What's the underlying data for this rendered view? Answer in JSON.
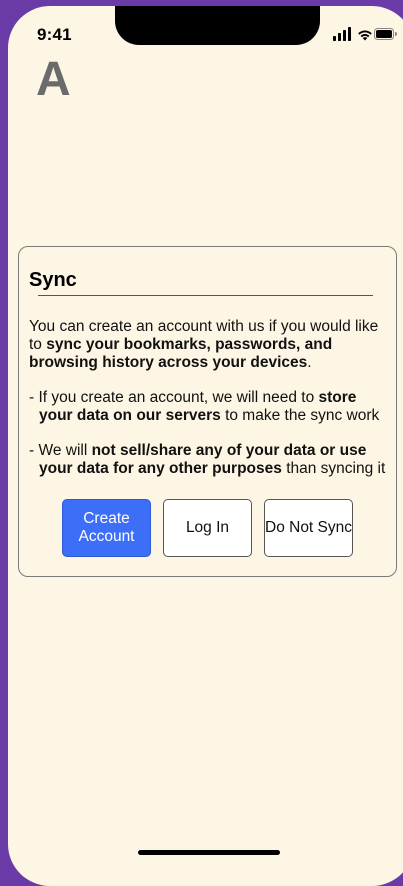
{
  "status_bar": {
    "time": "9:41",
    "icons": [
      "signal-icon",
      "wifi-icon",
      "battery-icon"
    ]
  },
  "app": {
    "logo_letter": "A"
  },
  "dialog": {
    "title": "Sync",
    "intro_prefix": "You can create an account with us if you would like to ",
    "intro_bold": "sync your bookmarks, passwords, and browsing history across your devices",
    "intro_suffix": ".",
    "bullet1_prefix": "- If you create an account, we will need to ",
    "bullet1_bold": "store your data on our servers",
    "bullet1_suffix": " to make the sync work",
    "bullet2_prefix": "- We will ",
    "bullet2_bold": "not sell/share any of your data or use your data for any other purposes",
    "bullet2_suffix": " than syncing it",
    "buttons": {
      "create": "Create Account",
      "login": "Log In",
      "no_sync": "Do Not Sync"
    }
  },
  "colors": {
    "background_frame": "#6a3aa6",
    "screen": "#fdf6e4",
    "primary_button": "#3d6ef7"
  }
}
